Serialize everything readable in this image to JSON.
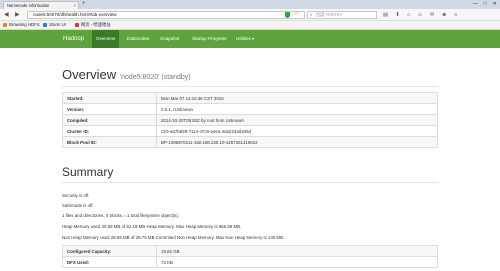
{
  "browser": {
    "tab_title": "Namenode information",
    "tab_close": "×",
    "new_tab": "+",
    "window_buttons": [
      "—",
      "□",
      "✕"
    ],
    "url": "node5:50070/dfshealth.html#tab-overview",
    "search_placeholder": "百度 <Ctrl+K>",
    "bookmarks": [
      {
        "label": "Browsing HDFS",
        "color": "#e07b2a"
      },
      {
        "label": "Storm UI",
        "color": "#2a7be0"
      },
      {
        "label": "网页 - 哈迷地址",
        "color": "#d13b3b"
      }
    ]
  },
  "navbar": {
    "brand": "Hadoop",
    "items": [
      "Overview",
      "Datanodes",
      "Snapshot",
      "Startup Progress",
      "Utilities"
    ],
    "caret": "▾"
  },
  "overview": {
    "title": "Overview",
    "subtitle": "'node5:8020' (standby)",
    "rows": [
      {
        "key": "Started:",
        "value": "Mon Mar 07 14:16:36 CST 2016"
      },
      {
        "key": "Version:",
        "value": "2.5.1, rUnknown"
      },
      {
        "key": "Compiled:",
        "value": "2014-10-20T05:53Z by root from Unknown"
      },
      {
        "key": "Cluster ID:",
        "value": "CID-a67b829-7114-47c9-a4ea-4da2233d405d"
      },
      {
        "key": "Block Pool ID:",
        "value": "BP-1095870311-192.168.230.10-1457351415622"
      }
    ]
  },
  "summary": {
    "title": "Summary",
    "lines": [
      "Security is off.",
      "Safemode is off.",
      "1 files and directories, 0 blocks = 1 total filesystem object(s).",
      "Heap Memory used 30.59 MB of 52.18 MB Heap Memory. Max Heap Memory is 966.69 MB.",
      "Non Heap Memory used 28.55 MB of 29.75 MB Commited Non Heap Memory. Max Non Heap Memory is 130 MB."
    ],
    "rows": [
      {
        "key": "Configured Capacity:",
        "value": "19.82 GB"
      },
      {
        "key": "DFS Used:",
        "value": "72 KB"
      }
    ]
  }
}
